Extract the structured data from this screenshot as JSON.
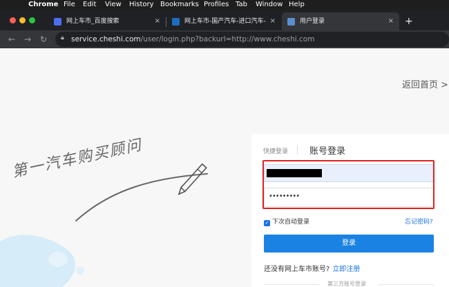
{
  "menubar": {
    "items": [
      "Chrome",
      "File",
      "Edit",
      "View",
      "History",
      "Bookmarks",
      "Profiles",
      "Tab",
      "Window",
      "Help"
    ]
  },
  "tabs": [
    {
      "label": "网上车市_百度搜索",
      "icon": "baidu-icon",
      "active": false
    },
    {
      "label": "网上车市-国产汽车-进口汽车-",
      "icon": "cheshi-icon",
      "active": false
    },
    {
      "label": "用户登录",
      "icon": "page-icon",
      "active": true
    }
  ],
  "tab_close_glyph": "×",
  "new_tab_glyph": "+",
  "address": {
    "host": "service.cheshi.com",
    "path": "/user/login.php?backurl=http://www.cheshi.com"
  },
  "page": {
    "back_home": "返回首页",
    "back_chevron": ">",
    "slogan": "第一汽车购买顾问",
    "login": {
      "tab_quick": "快捷登录",
      "tab_account": "账号登录",
      "password_masked": "•••••••••",
      "remember_label": "下次自动登录",
      "remember_checked": true,
      "forgot_label": "忘记密码?",
      "submit_label": "登录",
      "no_account_text": "还没有网上车市账号?",
      "register_label": "立即注册",
      "third_party_label": "第三方账号登录"
    }
  },
  "colors": {
    "accent": "#1a82e2",
    "highlight": "#e02020"
  }
}
